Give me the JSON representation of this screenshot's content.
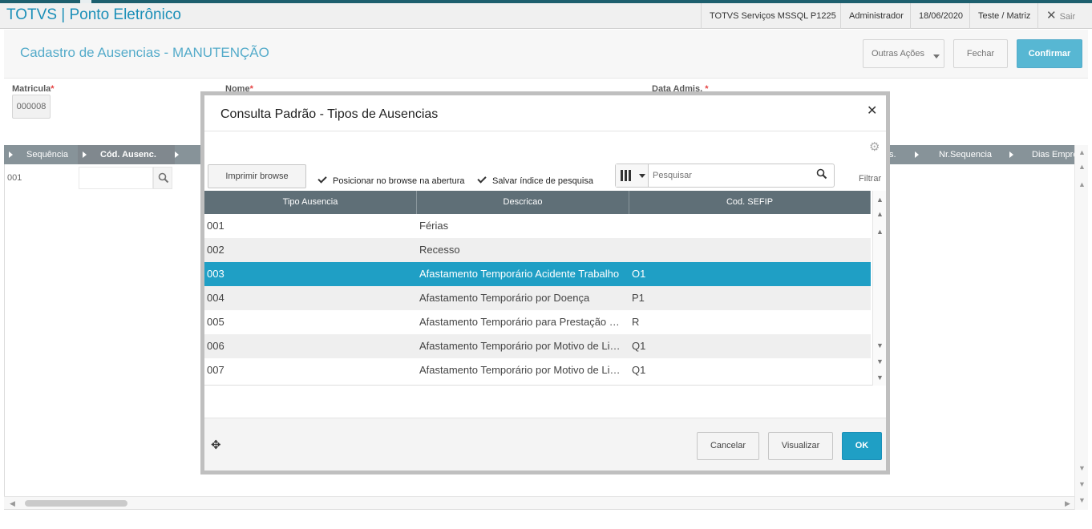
{
  "app": {
    "title": "TOTVS | Ponto Eletrônico"
  },
  "header": {
    "environment": "TOTVS Serviços MSSQL P1225",
    "user": "Administrador",
    "date": "18/06/2020",
    "branch": "Teste / Matriz",
    "exit_label": "Sair"
  },
  "page": {
    "title": "Cadastro de Ausencias - MANUTENÇÃO",
    "buttons": {
      "other_actions": "Outras Ações",
      "close": "Fechar",
      "confirm": "Confirmar"
    }
  },
  "form": {
    "matricula_label": "Matricula",
    "matricula_value": "000008",
    "nome_label": "Nome",
    "data_admis_label": "Data Admis.",
    "required_mark": "*"
  },
  "grid": {
    "columns": [
      "Sequência",
      "Cód. Ausenc.",
      "s.",
      "Nr.Sequencia",
      "Dias Empre"
    ],
    "row_sequence": "001"
  },
  "dialog": {
    "title": "Consulta Padrão - Tipos de Ausencias",
    "print_button": "Imprimir browse",
    "checkbox_position": "Posicionar no browse na abertura",
    "checkbox_save_index": "Salvar índice de pesquisa",
    "search_placeholder": "Pesquisar",
    "filter_label": "Filtrar",
    "table": {
      "columns": [
        "Tipo Ausencia",
        "Descricao",
        "Cod. SEFIP"
      ],
      "rows": [
        [
          "001",
          "Férias",
          ""
        ],
        [
          "002",
          "Recesso",
          ""
        ],
        [
          "003",
          "Afastamento Temporário Acidente Trabalho",
          "O1"
        ],
        [
          "004",
          "Afastamento Temporário por Doença",
          "P1"
        ],
        [
          "005",
          "Afastamento Temporário para Prestação de Serviço Militar",
          "R"
        ],
        [
          "006",
          "Afastamento Temporário por Motivo de Licença",
          "Q1"
        ],
        [
          "007",
          "Afastamento Temporário por Motivo de Licença",
          "Q1"
        ]
      ],
      "selected_row": 2
    },
    "footer": {
      "cancel": "Cancelar",
      "view": "Visualizar",
      "ok": "OK"
    }
  },
  "colors": {
    "accent": "#1f9fc5",
    "header_grid": "#5f6f77",
    "title_text": "#1b8fb8"
  }
}
